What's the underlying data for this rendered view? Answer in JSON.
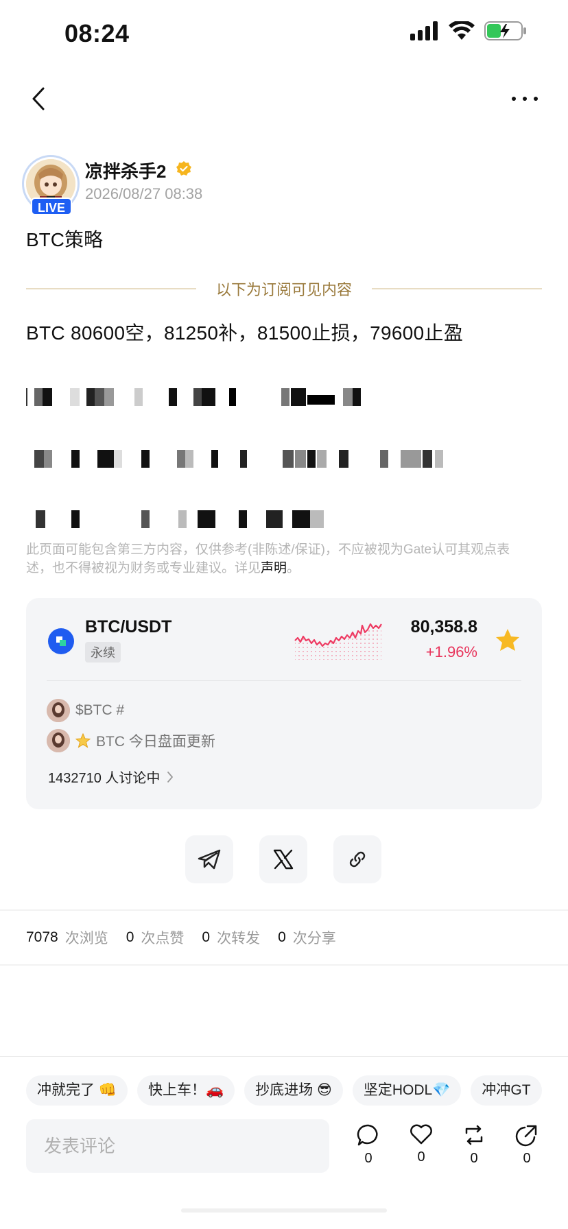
{
  "status_bar": {
    "time": "08:24"
  },
  "author": {
    "name": "凉拌杀手2",
    "time": "2026/08/27 08:38",
    "live_label": "LIVE"
  },
  "post": {
    "title": "BTC策略",
    "subscription_divider": "以下为订阅可见内容",
    "strategy_text": "BTC 80600空，81250补，81500止损，79600止盈",
    "disclaimer": "此页面可能包含第三方内容，仅供参考(非陈述/保证)，不应被视为Gate认可其观点表述，也不得被视为财务或专业建议。详见",
    "disclaimer_link": "声明",
    "disclaimer_end": "。"
  },
  "market_card": {
    "pair": "BTC/USDT",
    "tag": "永续",
    "price": "80,358.8",
    "change": "+1.96%",
    "change_color": "#e8325a",
    "topics": [
      {
        "text": "$BTC #"
      },
      {
        "text": "BTC 今日盘面更新"
      }
    ],
    "discussion": "1432710 人讨论中"
  },
  "share": [
    "telegram-icon",
    "x-icon",
    "link-icon"
  ],
  "stats": {
    "views_num": "7078",
    "views_label": "次浏览",
    "likes_num": "0",
    "likes_label": "次点赞",
    "reposts_num": "0",
    "reposts_label": "次转发",
    "shares_num": "0",
    "shares_label": "次分享"
  },
  "quick_replies": [
    "冲就完了 👊",
    "快上车！🚗",
    "抄底进场 😎",
    "坚定HODL💎",
    "冲冲GT"
  ],
  "comment": {
    "placeholder": "发表评论"
  },
  "actions": {
    "comment_count": "0",
    "like_count": "0",
    "repost_count": "0",
    "share_count": "0"
  }
}
